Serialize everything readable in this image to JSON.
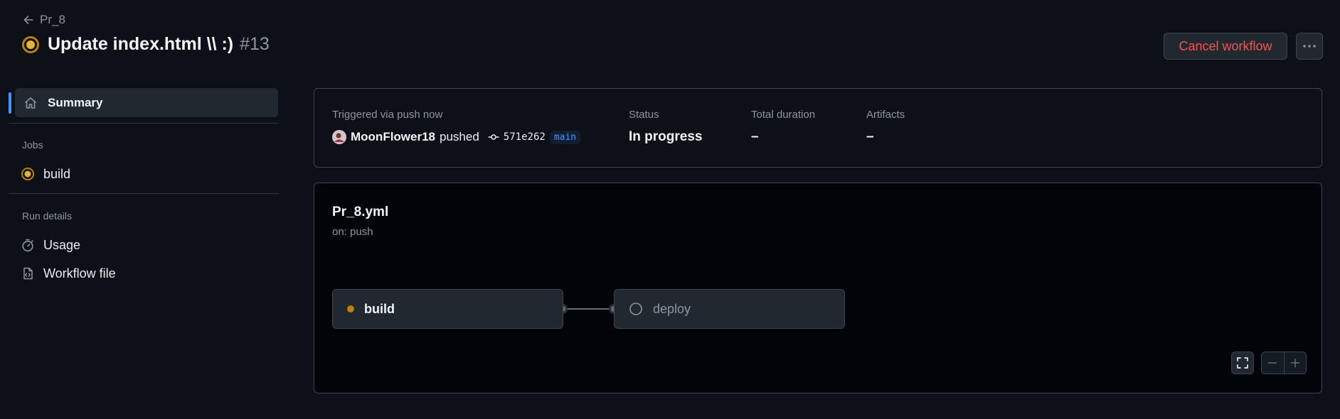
{
  "header": {
    "back_label": "Pr_8",
    "title": "Update index.html \\\\ :)",
    "run_number": "#13",
    "status_icon": "in-progress-icon",
    "cancel_label": "Cancel workflow",
    "more_icon": "kebab-horizontal-icon"
  },
  "sidebar": {
    "summary_label": "Summary",
    "jobs_heading": "Jobs",
    "jobs": [
      {
        "label": "build",
        "status": "in_progress"
      }
    ],
    "run_details_heading": "Run details",
    "run_details": [
      {
        "label": "Usage",
        "icon": "stopwatch-icon"
      },
      {
        "label": "Workflow file",
        "icon": "file-code-icon"
      }
    ]
  },
  "summary": {
    "trigger_label": "Triggered via push now",
    "actor": "MoonFlower18",
    "action": "pushed",
    "commit_sha": "571e262",
    "branch": "main",
    "status_label": "Status",
    "status_value": "In progress",
    "duration_label": "Total duration",
    "duration_value": "–",
    "artifacts_label": "Artifacts",
    "artifacts_value": "–"
  },
  "workflow": {
    "file_name": "Pr_8.yml",
    "trigger": "on: push",
    "jobs": [
      {
        "label": "build",
        "status": "in_progress"
      },
      {
        "label": "deploy",
        "status": "queued"
      }
    ]
  },
  "colors": {
    "background": "#0d1117",
    "canvas": "#010409",
    "border": "#3d444d",
    "danger": "#f85149",
    "accent": "#4493f8",
    "in_progress": "#bb8009"
  }
}
